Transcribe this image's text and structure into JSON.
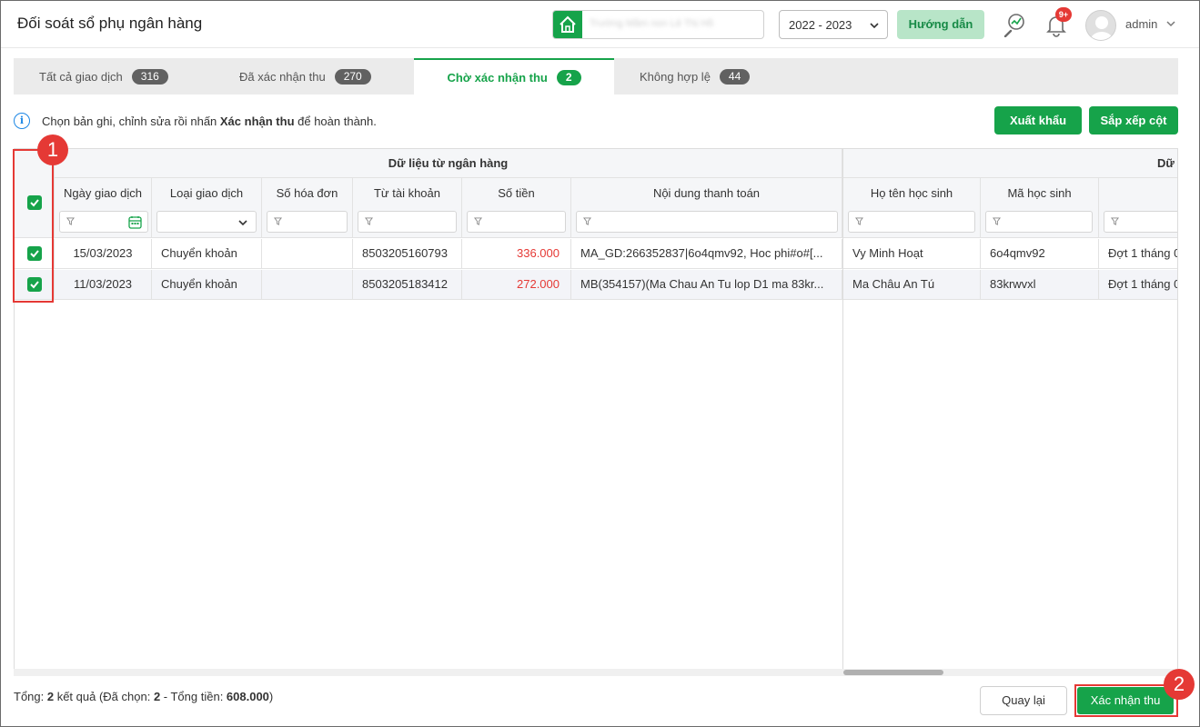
{
  "header": {
    "title": "Đối soát sổ phụ ngân hàng",
    "school_name": "Trường Mầm non Lê Thị Hồ",
    "school_year": "2022 - 2023",
    "guide_label": "Hướng dẫn",
    "notification_badge": "9+",
    "user_name": "admin"
  },
  "tabs": [
    {
      "label": "Tất cả giao dịch",
      "count": "316"
    },
    {
      "label": "Đã xác nhận thu",
      "count": "270"
    },
    {
      "label": "Chờ xác nhận thu",
      "count": "2"
    },
    {
      "label": "Không hợp lệ",
      "count": "44"
    }
  ],
  "info": {
    "text_before": "Chọn bản ghi, chỉnh sửa rồi nhấn ",
    "text_bold": "Xác nhận thu",
    "text_after": " để hoàn thành."
  },
  "actions": {
    "export_label": "Xuất khẩu",
    "arrange_label": "Sắp xếp cột"
  },
  "table": {
    "group_bank": "Dữ liệu từ ngân hàng",
    "group_data": "Dữ",
    "columns": {
      "date": "Ngày giao dịch",
      "type": "Loại giao dịch",
      "invoice": "Số hóa đơn",
      "account": "Từ tài khoản",
      "amount": "Số tiền",
      "content": "Nội dung thanh toán",
      "student_name": "Họ tên học sinh",
      "student_code": "Mã học sinh"
    },
    "rows": [
      {
        "date": "15/03/2023",
        "type": "Chuyển khoản",
        "invoice": "",
        "account": "8503205160793",
        "amount": "336.000",
        "content": "MA_GD:266352837|6o4qmv92, Hoc phi#o#[...",
        "student_name": "Vy Minh Hoạt",
        "student_code": "6o4qmv92",
        "period": "Đợt 1 tháng 0"
      },
      {
        "date": "11/03/2023",
        "type": "Chuyển khoản",
        "invoice": "",
        "account": "8503205183412",
        "amount": "272.000",
        "content": "MB(354157)(Ma Chau An Tu lop D1 ma 83kr...",
        "student_name": "Ma Châu An Tú",
        "student_code": "83krwvxl",
        "period": "Đợt 1 tháng 0"
      }
    ]
  },
  "footer": {
    "summary_prefix": "Tổng: ",
    "total_results": "2",
    "summary_mid1": " kết quả (Đã chọn: ",
    "selected": "2",
    "summary_mid2": " - Tổng tiền: ",
    "total_amount": "608.000",
    "summary_suffix": ")",
    "back_label": "Quay lại",
    "confirm_label": "Xác nhận thu"
  },
  "annotations": {
    "marker_1": "1",
    "marker_2": "2"
  },
  "colors": {
    "accent": "#16a34a",
    "highlight": "#e53935",
    "money": "#e53935"
  }
}
